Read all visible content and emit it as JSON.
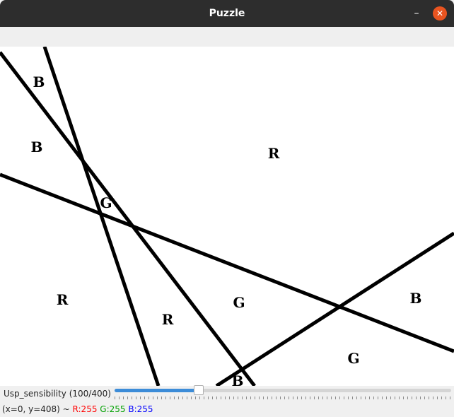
{
  "window": {
    "title": "Puzzle",
    "minimize_glyph": "–",
    "close_glyph": "✕",
    "close_color": "#e95420"
  },
  "puzzle": {
    "line_color": "#000000",
    "labels": [
      {
        "text": "B"
      },
      {
        "text": "B"
      },
      {
        "text": "R"
      },
      {
        "text": "G"
      },
      {
        "text": "R"
      },
      {
        "text": "R"
      },
      {
        "text": "G"
      },
      {
        "text": "B"
      },
      {
        "text": "G"
      },
      {
        "text": "B"
      }
    ]
  },
  "trackbar": {
    "label": "Usp_sensibility (100/400)",
    "value": 100,
    "max": 400,
    "fill_color": "#3c8cd8"
  },
  "status": {
    "coords": "(x=0, y=408) ~",
    "r": "R:255",
    "g": "G:255",
    "b": "B:255"
  }
}
